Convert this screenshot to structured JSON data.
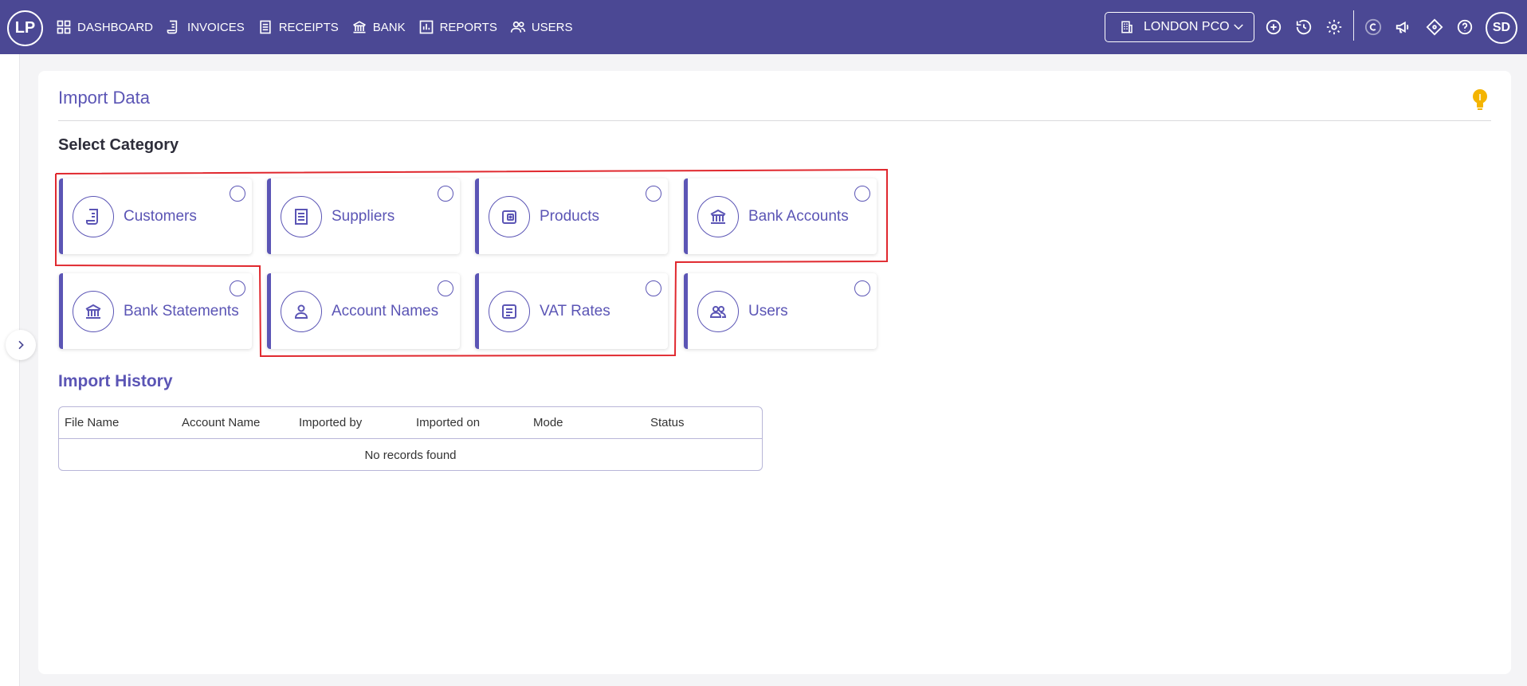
{
  "header": {
    "logo": "LP",
    "nav": [
      {
        "label": "DASHBOARD",
        "icon": "dashboard-icon"
      },
      {
        "label": "INVOICES",
        "icon": "invoice-icon"
      },
      {
        "label": "RECEIPTS",
        "icon": "receipt-icon"
      },
      {
        "label": "BANK",
        "icon": "bank-icon"
      },
      {
        "label": "REPORTS",
        "icon": "reports-icon"
      },
      {
        "label": "USERS",
        "icon": "users-icon"
      }
    ],
    "org": "LONDON PCO",
    "avatar": "SD"
  },
  "page": {
    "title": "Import Data",
    "select_category": "Select Category",
    "categories": [
      {
        "label": "Customers",
        "icon": "customers-icon"
      },
      {
        "label": "Suppliers",
        "icon": "suppliers-icon"
      },
      {
        "label": "Products",
        "icon": "products-icon"
      },
      {
        "label": "Bank Accounts",
        "icon": "bank-icon"
      },
      {
        "label": "Bank Statements",
        "icon": "bank-icon"
      },
      {
        "label": "Account Names",
        "icon": "person-icon"
      },
      {
        "label": "VAT Rates",
        "icon": "document-icon"
      },
      {
        "label": "Users",
        "icon": "users-icon"
      }
    ],
    "history_title": "Import History",
    "table": {
      "columns": [
        "File Name",
        "Account Name",
        "Imported by",
        "Imported on",
        "Mode",
        "Status"
      ],
      "empty_text": "No records found"
    }
  },
  "colors": {
    "header_bg": "#4b4894",
    "accent": "#5b55b5",
    "highlight": "#e0282e",
    "bulb": "#f4b400"
  }
}
